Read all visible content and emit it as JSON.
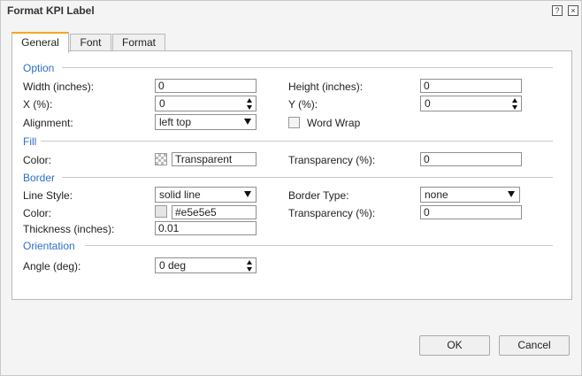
{
  "window": {
    "title": "Format KPI Label",
    "help_label": "?",
    "close_label": "×"
  },
  "tabs": [
    {
      "label": "General",
      "active": true
    },
    {
      "label": "Font",
      "active": false
    },
    {
      "label": "Format",
      "active": false
    }
  ],
  "option": {
    "section_label": "Option",
    "width": {
      "label": "Width (inches):",
      "value": "0"
    },
    "height": {
      "label": "Height (inches):",
      "value": "0"
    },
    "x": {
      "label": "X (%):",
      "value": "0"
    },
    "y": {
      "label": "Y (%):",
      "value": "0"
    },
    "alignment": {
      "label": "Alignment:",
      "value": "left top"
    },
    "word_wrap": {
      "label": "Word Wrap",
      "checked": false
    }
  },
  "fill": {
    "section_label": "Fill",
    "color": {
      "label": "Color:",
      "value": "Transparent"
    },
    "transparency": {
      "label": "Transparency (%):",
      "value": "0"
    }
  },
  "border": {
    "section_label": "Border",
    "line_style": {
      "label": "Line Style:",
      "value": "solid line"
    },
    "border_type": {
      "label": "Border Type:",
      "value": "none"
    },
    "color": {
      "label": "Color:",
      "value": "#e5e5e5",
      "swatch": "#e5e5e5"
    },
    "transparency": {
      "label": "Transparency (%):",
      "value": "0"
    },
    "thickness": {
      "label": "Thickness (inches):",
      "value": "0.01"
    }
  },
  "orientation": {
    "section_label": "Orientation",
    "angle": {
      "label": "Angle (deg):",
      "value": "0 deg"
    }
  },
  "buttons": {
    "ok": "OK",
    "cancel": "Cancel"
  },
  "colors": {
    "section_text": "#2d6fc6",
    "active_tab_accent": "#f5a623",
    "dialog_bg": "#f4f4f4"
  }
}
